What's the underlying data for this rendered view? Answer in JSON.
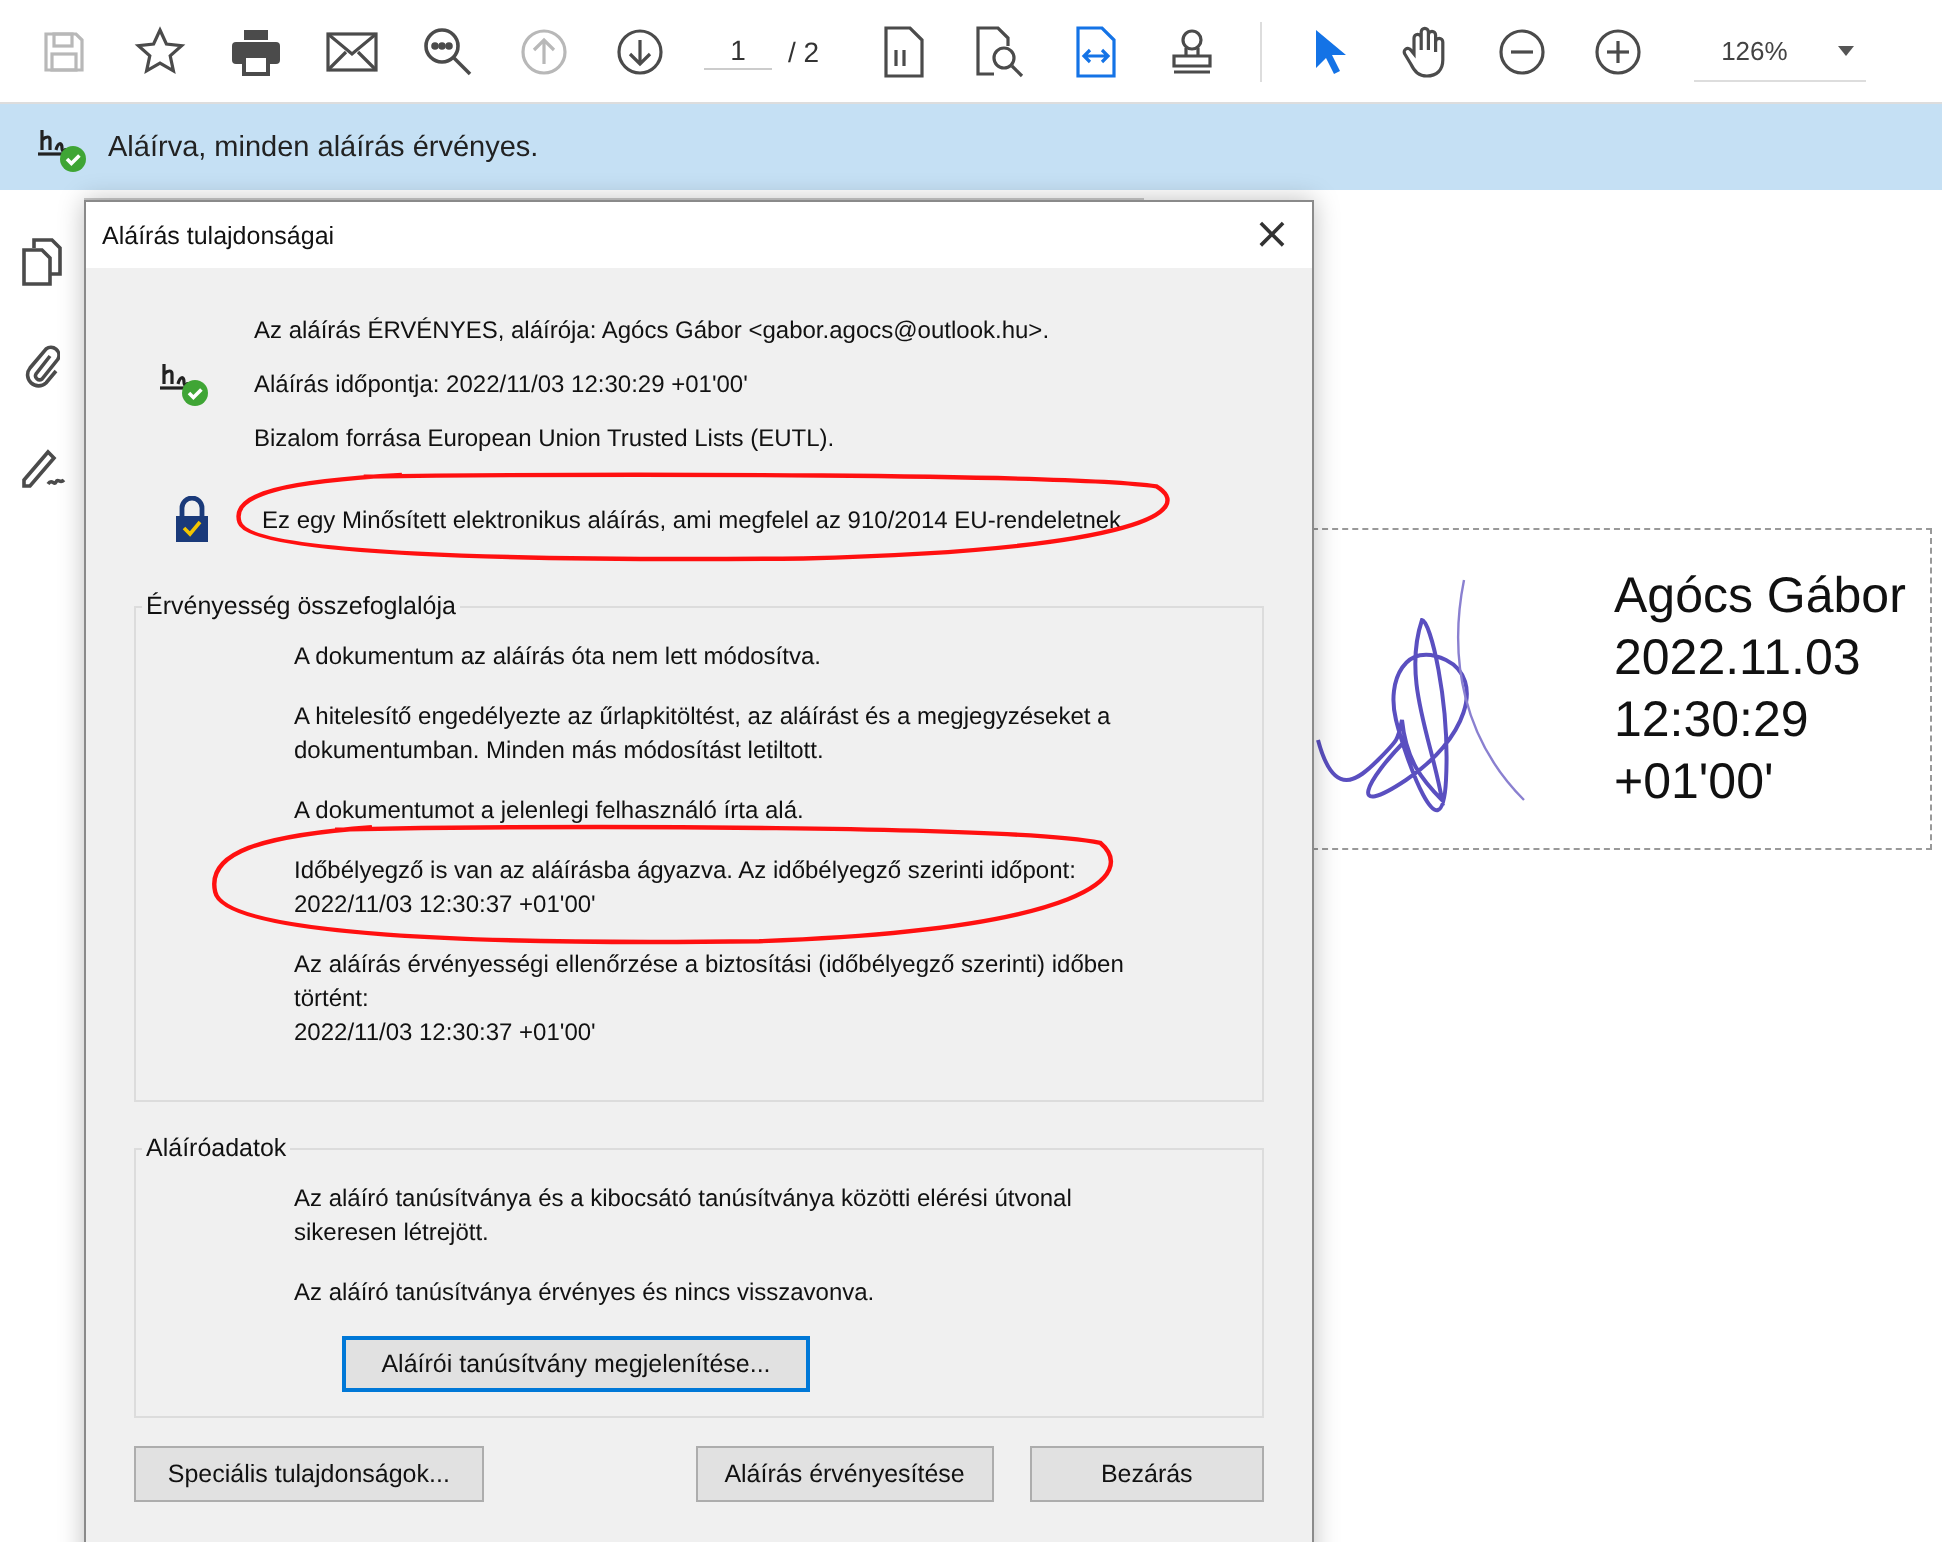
{
  "toolbar": {
    "tools_left": [
      {
        "kind": "save",
        "disabled": true,
        "selected": false
      },
      {
        "kind": "star",
        "disabled": false,
        "selected": false
      },
      {
        "kind": "print",
        "disabled": false,
        "selected": false
      },
      {
        "kind": "mail",
        "disabled": false,
        "selected": false
      },
      {
        "kind": "zoom-search",
        "disabled": false,
        "selected": false
      },
      {
        "kind": "up",
        "disabled": true,
        "selected": false
      },
      {
        "kind": "down",
        "disabled": false,
        "selected": false
      }
    ],
    "page_field": {
      "value": "1"
    },
    "page_total": "/ 2",
    "tools_mid": [
      {
        "kind": "fit-page",
        "disabled": false,
        "selected": false
      },
      {
        "kind": "find",
        "disabled": false,
        "selected": false
      },
      {
        "kind": "fit-width",
        "disabled": false,
        "selected": true
      },
      {
        "kind": "stamp",
        "disabled": false,
        "selected": false
      }
    ],
    "tools_right": [
      {
        "kind": "pointer",
        "disabled": false,
        "selected": true
      },
      {
        "kind": "hand",
        "disabled": false,
        "selected": false
      },
      {
        "kind": "minus",
        "disabled": false,
        "selected": false
      },
      {
        "kind": "plus",
        "disabled": false,
        "selected": false
      }
    ],
    "zoom": {
      "value": "126%"
    }
  },
  "banner": {
    "text": "Aláírva, minden aláírás érvényes."
  },
  "sidebar": {
    "tools": [
      {
        "kind": "pages"
      },
      {
        "kind": "attachment"
      },
      {
        "kind": "sign"
      }
    ]
  },
  "signature_field": {
    "text": "Agócs Gábor\n2022.11.03\n12:30:29\n+01'00'"
  },
  "dialog": {
    "title": "Aláírás tulajdonságai",
    "close": "×",
    "header_lines": [
      "Az aláírás ÉRVÉNYES, aláírója: Agócs Gábor <gabor.agocs@outlook.hu>.",
      "Aláírás időpontja:  2022/11/03 12:30:29 +01'00'",
      "Bizalom forrása European Union Trusted Lists (EUTL)."
    ],
    "qualified_line": {
      "text": "Ez egy Minősített elektronikus aláírás, ami megfelel az 910/2014 EU-rendeletnek",
      "annotated": true
    },
    "groups": [
      {
        "legend": "Érvényesség összefoglalója",
        "paragraphs": [
          {
            "text": "A dokumentum az aláírás óta nem lett módosítva.",
            "annotated": false
          },
          {
            "text": "A hitelesítő engedélyezte az űrlapkitöltést, az aláírást és a megjegyzéseket a\ndokumentumban. Minden más módosítást letiltott.",
            "annotated": false
          },
          {
            "text": "A dokumentumot a jelenlegi felhasználó írta alá.",
            "annotated": false
          },
          {
            "text": "Időbélyegző is van az aláírásba ágyazva. Az időbélyegző szerinti időpont:\n2022/11/03 12:30:37 +01'00'",
            "annotated": true
          },
          {
            "text": "Az aláírás érvényességi ellenőrzése a biztosítási (időbélyegző szerinti) időben\ntörtént:\n2022/11/03 12:30:37 +01'00'",
            "annotated": false
          }
        ]
      },
      {
        "legend": "Aláíróadatok",
        "paragraphs": [
          {
            "text": "Az aláíró tanúsítványa és a kibocsátó tanúsítványa közötti elérési útvonal\nsikeresen létrejött.",
            "annotated": false
          },
          {
            "text": "Az aláíró tanúsítványa érvényes és nincs visszavonva.",
            "annotated": false
          }
        ],
        "button": "Aláírói tanúsítvány megjelenítése..."
      }
    ],
    "buttons": [
      "Speciális tulajdonságok...",
      "Aláírás érvényesítése",
      "Bezárás"
    ]
  }
}
